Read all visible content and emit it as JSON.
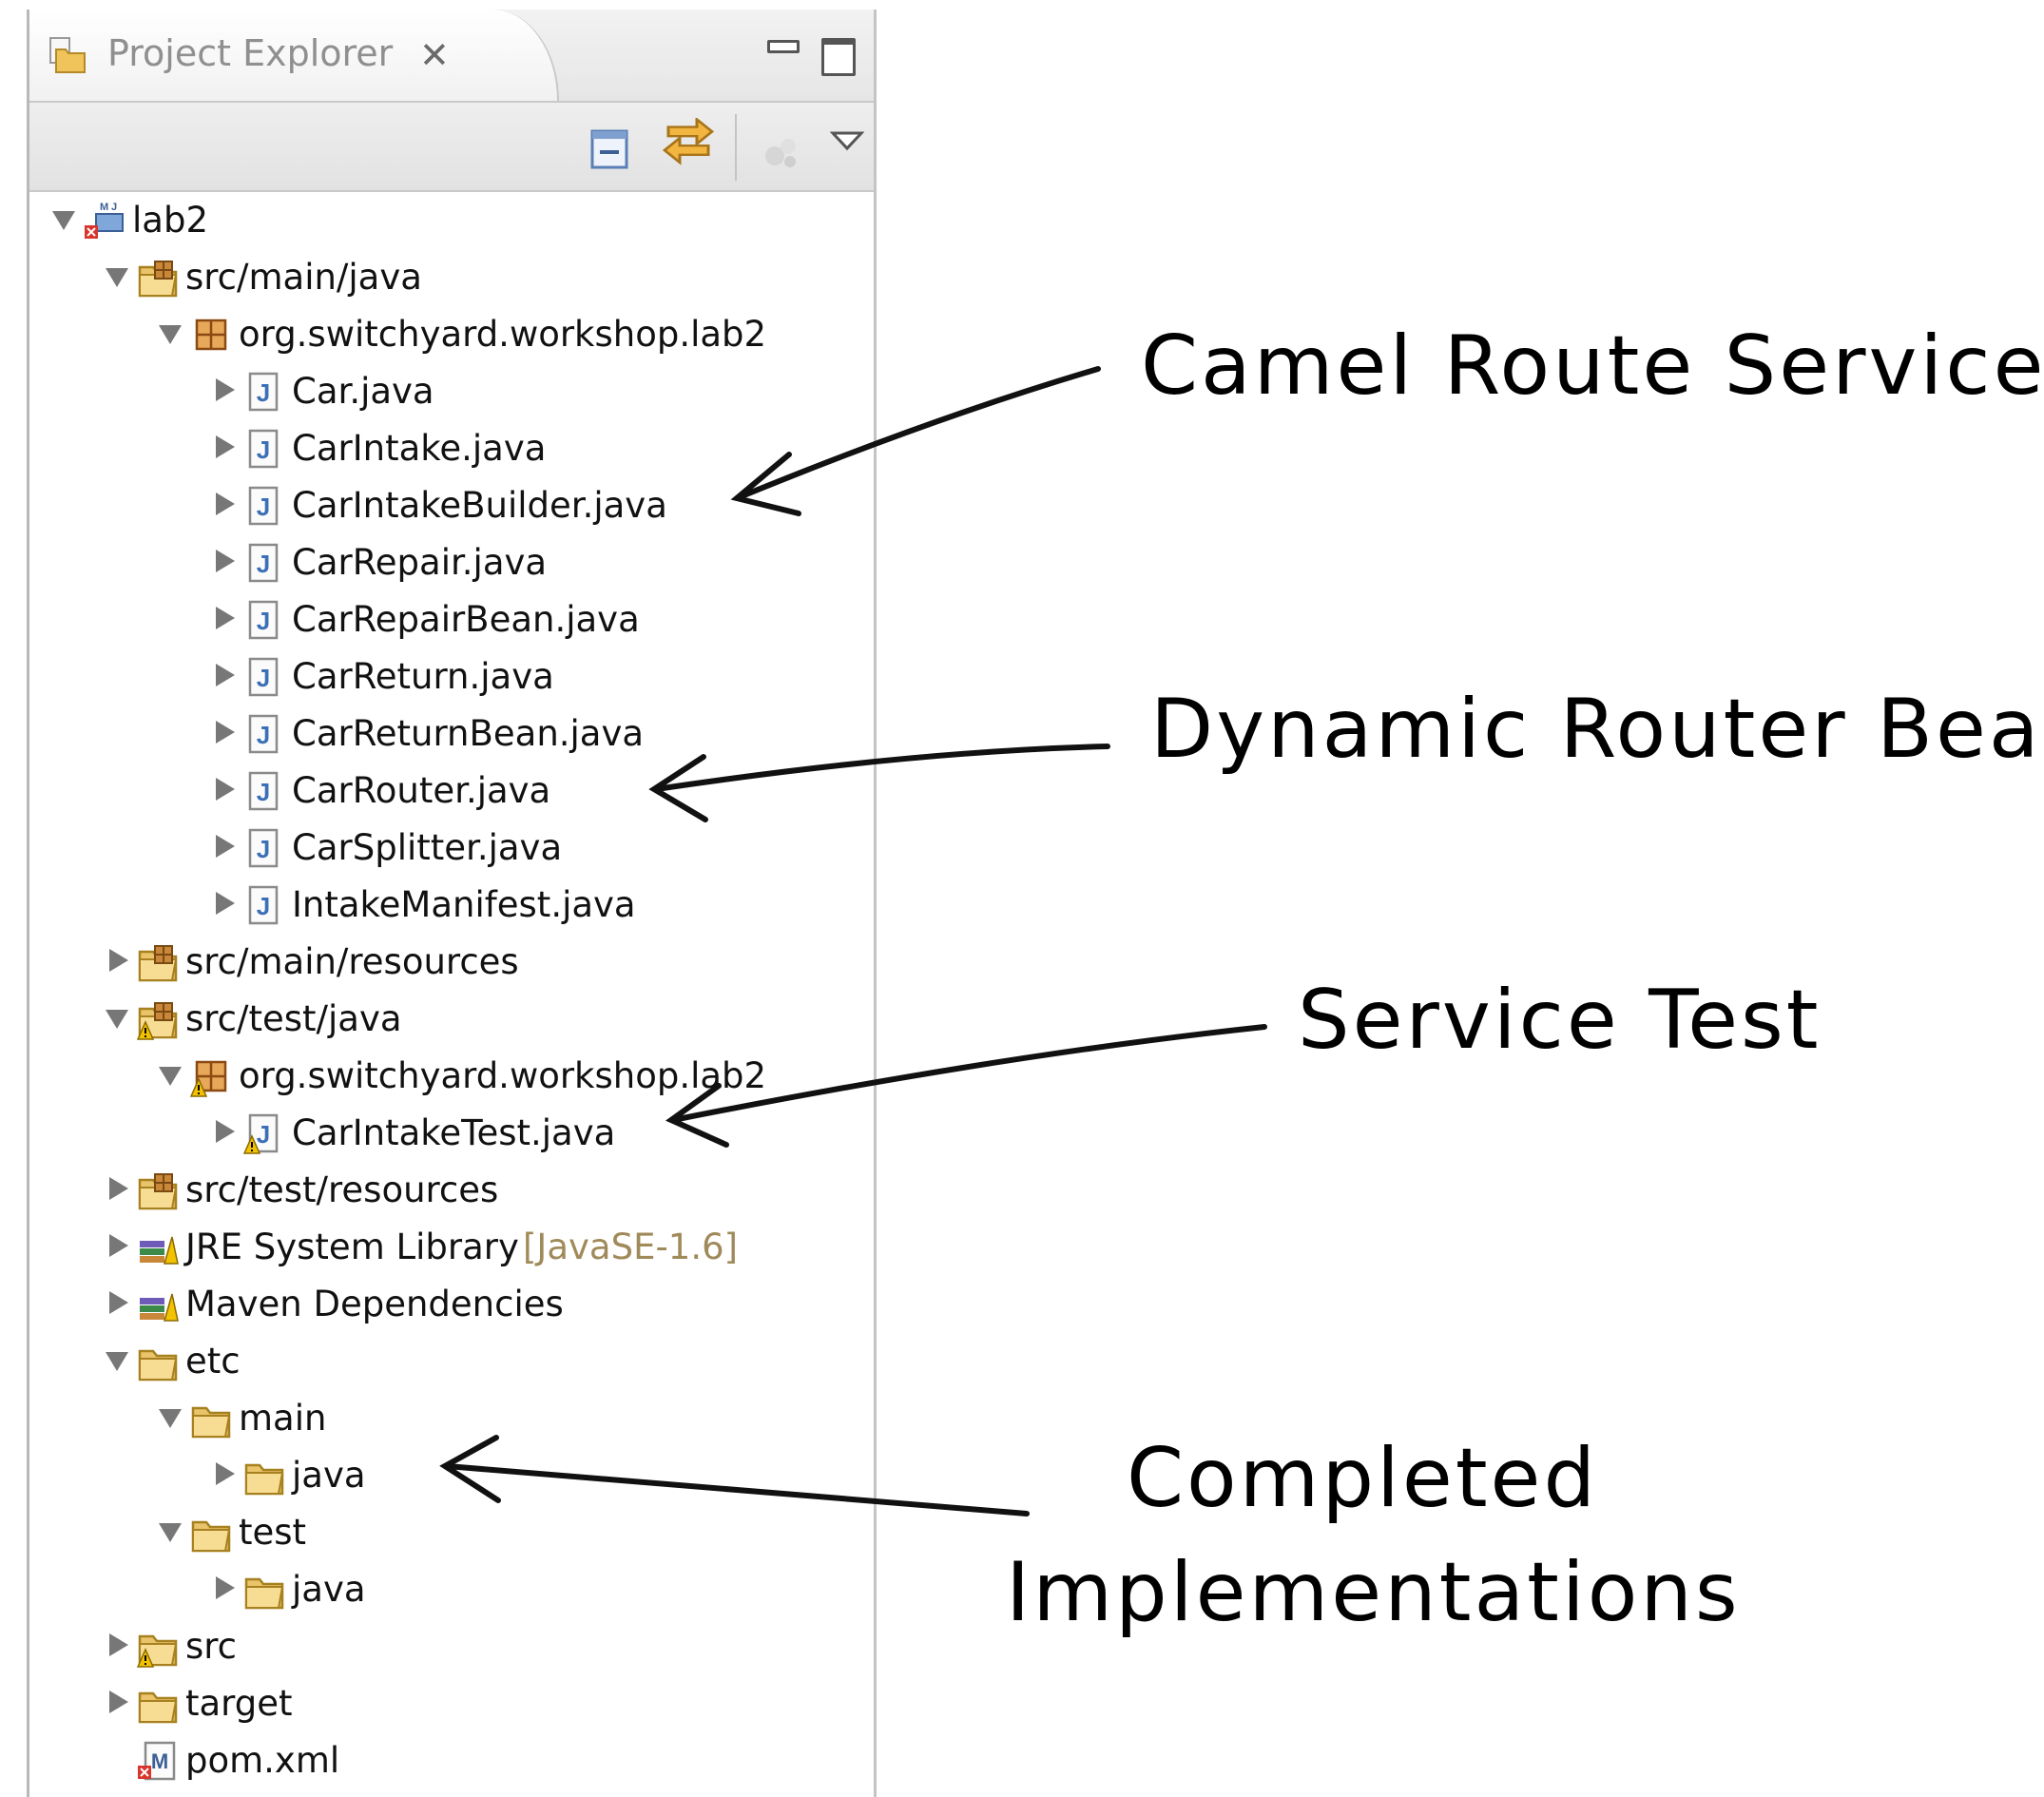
{
  "view": {
    "title": "Project Explorer",
    "close_glyph": "✕"
  },
  "icons": {
    "tab": "project-explorer-icon",
    "collapse_all": "collapse-all-icon",
    "link_with_editor": "link-with-editor-icon",
    "filter": "filter-icon",
    "view_menu": "view-menu-icon"
  },
  "tree": [
    {
      "depth": 0,
      "state": "expanded",
      "icon": "maven-project",
      "label": "lab2"
    },
    {
      "depth": 1,
      "state": "expanded",
      "icon": "source-folder",
      "label": "src/main/java"
    },
    {
      "depth": 2,
      "state": "expanded",
      "icon": "package",
      "label": "org.switchyard.workshop.lab2"
    },
    {
      "depth": 3,
      "state": "collapsed",
      "icon": "java-file",
      "label": "Car.java"
    },
    {
      "depth": 3,
      "state": "collapsed",
      "icon": "java-file",
      "label": "CarIntake.java"
    },
    {
      "depth": 3,
      "state": "collapsed",
      "icon": "java-file",
      "label": "CarIntakeBuilder.java"
    },
    {
      "depth": 3,
      "state": "collapsed",
      "icon": "java-file",
      "label": "CarRepair.java"
    },
    {
      "depth": 3,
      "state": "collapsed",
      "icon": "java-file",
      "label": "CarRepairBean.java"
    },
    {
      "depth": 3,
      "state": "collapsed",
      "icon": "java-file",
      "label": "CarReturn.java"
    },
    {
      "depth": 3,
      "state": "collapsed",
      "icon": "java-file",
      "label": "CarReturnBean.java"
    },
    {
      "depth": 3,
      "state": "collapsed",
      "icon": "java-file",
      "label": "CarRouter.java"
    },
    {
      "depth": 3,
      "state": "collapsed",
      "icon": "java-file",
      "label": "CarSplitter.java"
    },
    {
      "depth": 3,
      "state": "collapsed",
      "icon": "java-file",
      "label": "IntakeManifest.java"
    },
    {
      "depth": 1,
      "state": "collapsed",
      "icon": "source-folder",
      "label": "src/main/resources"
    },
    {
      "depth": 1,
      "state": "expanded",
      "icon": "source-folder-warning",
      "label": "src/test/java"
    },
    {
      "depth": 2,
      "state": "expanded",
      "icon": "package-warning",
      "label": "org.switchyard.workshop.lab2"
    },
    {
      "depth": 3,
      "state": "collapsed",
      "icon": "java-file-warning",
      "label": "CarIntakeTest.java"
    },
    {
      "depth": 1,
      "state": "collapsed",
      "icon": "source-folder",
      "label": "src/test/resources"
    },
    {
      "depth": 1,
      "state": "collapsed",
      "icon": "library",
      "label": "JRE System Library",
      "decoration": "[JavaSE-1.6]"
    },
    {
      "depth": 1,
      "state": "collapsed",
      "icon": "library",
      "label": "Maven Dependencies"
    },
    {
      "depth": 1,
      "state": "expanded",
      "icon": "folder",
      "label": "etc"
    },
    {
      "depth": 2,
      "state": "expanded",
      "icon": "folder",
      "label": "main"
    },
    {
      "depth": 3,
      "state": "collapsed",
      "icon": "folder",
      "label": "java"
    },
    {
      "depth": 2,
      "state": "expanded",
      "icon": "folder",
      "label": "test"
    },
    {
      "depth": 3,
      "state": "collapsed",
      "icon": "folder",
      "label": "java"
    },
    {
      "depth": 1,
      "state": "collapsed",
      "icon": "folder-warning",
      "label": "src"
    },
    {
      "depth": 1,
      "state": "collapsed",
      "icon": "folder",
      "label": "target"
    },
    {
      "depth": 1,
      "state": "none",
      "icon": "maven-pom",
      "label": "pom.xml"
    }
  ],
  "annotations": [
    {
      "text": "Camel Route Service",
      "points_to": "CarIntakeBuilder.java"
    },
    {
      "text": "Dynamic Router Bean",
      "points_to": "CarRouter.java"
    },
    {
      "text": "Service Test",
      "points_to": "CarIntakeTest.java"
    },
    {
      "text": "Completed\nImplementations",
      "lines": [
        "Completed",
        "Implementations"
      ],
      "points_to": "etc/main/java"
    }
  ],
  "colors": {
    "folder": "#e9c46a",
    "java": "#3b6fb6",
    "warning": "#f2c200",
    "error": "#d9342b",
    "decoration": "#a08a5a"
  }
}
